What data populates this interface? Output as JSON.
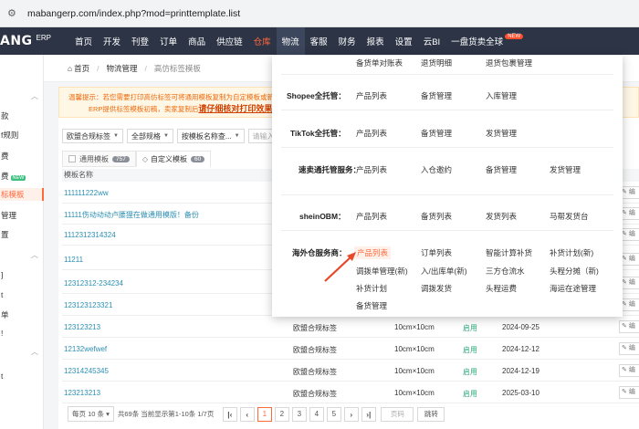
{
  "browser": {
    "url": "mabangerp.com/index.php?mod=printtemplate.list"
  },
  "logo": {
    "left": "ANG",
    "badge": "G",
    "suffix": "ERP"
  },
  "nav": [
    {
      "label": "首页"
    },
    {
      "label": "开发"
    },
    {
      "label": "刊登"
    },
    {
      "label": "订单"
    },
    {
      "label": "商品"
    },
    {
      "label": "供应链"
    },
    {
      "label": "仓库"
    },
    {
      "label": "物流"
    },
    {
      "label": "客服"
    },
    {
      "label": "财务"
    },
    {
      "label": "报表"
    },
    {
      "label": "设置"
    },
    {
      "label": "云BI"
    },
    {
      "label": "一盘货卖全球"
    }
  ],
  "nav_new": "NEW",
  "sidebar": {
    "items": [
      "款",
      "f规则",
      "费",
      "费",
      "标模板",
      "管理",
      "置",
      "",
      "",
      "",
      "单",
      "",
      "",
      ""
    ],
    "new_badge": "NEW"
  },
  "breadcrumb": {
    "home": "首页",
    "section": "物流管理",
    "current": "高仿标签模板"
  },
  "notice": {
    "line1": "温馨提示：若您需要打印高仿标签可将通用模板复制为自定模板或新增",
    "line2": "ERP提供标签模板初稿，卖家复制后",
    "link": "请仔细核对打印效果"
  },
  "filters": [
    {
      "label": "欧盟合规标签"
    },
    {
      "label": "全部规格"
    },
    {
      "label": "按模板名称查..."
    }
  ],
  "filter_input": "请输入关",
  "tabs": {
    "general": {
      "label": "通用模板",
      "count": "757"
    },
    "custom": {
      "label": "自定义模板",
      "count": "60"
    }
  },
  "table": {
    "header": "模板名称",
    "edit_label": "编",
    "rows": [
      {
        "name": "111111222ww",
        "type": "",
        "size": "",
        "status": "",
        "date": ""
      },
      {
        "name": "11111伤动动动卢腰狸在做通用模版！备份",
        "type": "",
        "size": "",
        "status": "",
        "date": ""
      },
      {
        "name": "1112312314324",
        "type": "",
        "size": "",
        "status": "",
        "date": ""
      },
      {
        "name": "11211",
        "type": "",
        "size": "",
        "status": "",
        "date": ""
      },
      {
        "name": "12312312-234234",
        "type": "",
        "size": "",
        "status": "",
        "date": ""
      },
      {
        "name": "123123123321",
        "type": "",
        "size": "",
        "status": "",
        "date": ""
      },
      {
        "name": "123123213",
        "type": "欧盟合规标签",
        "size": "10cm×10cm",
        "status": "启用",
        "date": "2024-09-25"
      },
      {
        "name": "12132wefwef",
        "type": "欧盟合规标签",
        "size": "10cm×10cm",
        "status": "启用",
        "date": "2024-12-12"
      },
      {
        "name": "12314245345",
        "type": "欧盟合规标签",
        "size": "10cm×10cm",
        "status": "启用",
        "date": "2024-12-19"
      },
      {
        "name": "123213213",
        "type": "欧盟合规标签",
        "size": "10cm×10cm",
        "status": "启用",
        "date": "2025-03-10"
      }
    ]
  },
  "pager": {
    "page_size": "每页 10 条",
    "summary": "共69条 当前显示第1-10条 1/7页",
    "pages": [
      "1",
      "2",
      "3",
      "4",
      "5"
    ],
    "jump_placeholder": "页码",
    "go": "跳转"
  },
  "mega": {
    "top_links": [
      "备货单对账表",
      "退货明细",
      "退货包裹管理"
    ],
    "groups": [
      {
        "name": "Shopee全托管：",
        "links": [
          "产品列表",
          "备货管理",
          "入库管理"
        ]
      },
      {
        "name": "TikTok全托管：",
        "links": [
          "产品列表",
          "备货管理",
          "发货管理"
        ]
      },
      {
        "name": "速卖通托管服务：",
        "links": [
          "产品列表",
          "入仓邀约",
          "备货管理",
          "发货管理"
        ]
      },
      {
        "name": "sheinOBM：",
        "links": [
          "产品列表",
          "备货列表",
          "发货列表",
          "马帮发货台"
        ]
      },
      {
        "name": "海外仓服务商：",
        "links": [
          "产品列表",
          "订单列表",
          "智能计算补货",
          "补货计划(新)",
          "调拨单管理(新)",
          "入/出库单(新)",
          "三方仓流水",
          "头程分摊（新)",
          "补货计划",
          "调拨发货",
          "头程运费",
          "海运在途管理",
          "备货管理"
        ]
      }
    ]
  },
  "colors": {
    "accent": "#ff6a3d",
    "nav_bg": "#2d3446",
    "link": "#2b8fb3",
    "enabled": "#2aa876"
  }
}
